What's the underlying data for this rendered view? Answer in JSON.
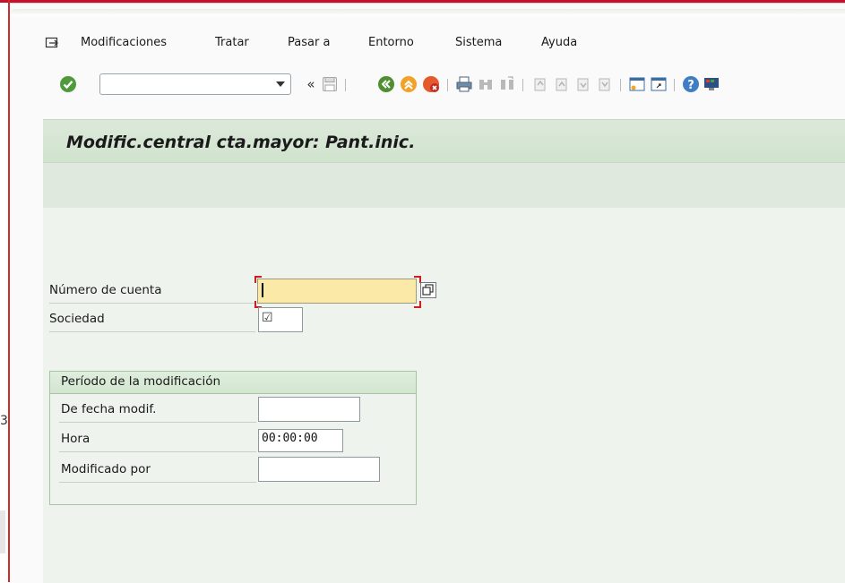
{
  "menu": {
    "items": [
      "Modificaciones",
      "Tratar",
      "Pasar a",
      "Entorno",
      "Sistema",
      "Ayuda"
    ]
  },
  "toolbar": {
    "command_value": "",
    "back_symbol": "«"
  },
  "screen": {
    "title": "Modific.central cta.mayor: Pant.inic."
  },
  "fields": {
    "account_label": "Número de cuenta",
    "account_value": "",
    "company_label": "Sociedad",
    "company_value": "☑"
  },
  "period": {
    "group_title": "Período de la modificación",
    "date_label": "De fecha modif.",
    "date_value": "",
    "time_label": "Hora",
    "time_value": "00:00:00",
    "changed_by_label": "Modificado por",
    "changed_by_value": ""
  },
  "side": {
    "glyph": "3"
  },
  "colors": {
    "header_green": "#d0e3cd",
    "required_yellow": "#fbe9a8",
    "accent_red": "#c8102e"
  }
}
